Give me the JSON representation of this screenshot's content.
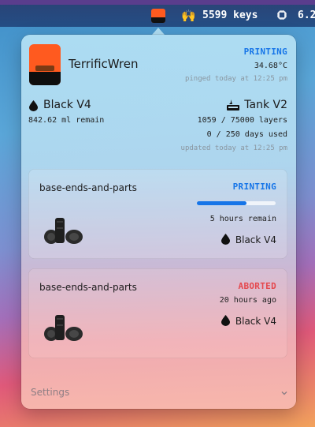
{
  "menubar": {
    "app_icon": "printer-app-icon",
    "raise_emoji": "🙌",
    "keys_text": "5599 keys",
    "chip_icon": "chip-icon",
    "right_text": "6.2"
  },
  "printer": {
    "name": "TerrificWren",
    "status": "PRINTING",
    "temperature": "34.68°C",
    "pinged": "pinged today at 12:25 pm"
  },
  "resin": {
    "name": "Black V4",
    "remain": "842.62 ml remain"
  },
  "tank": {
    "name": "Tank V2",
    "layers": "1059 / 75000 layers",
    "days": "0 / 250 days used",
    "updated": "updated today at 12:25 pm"
  },
  "jobs": [
    {
      "name": "base-ends-and-parts",
      "status": "PRINTING",
      "progress": 0.63,
      "time": "5 hours remain",
      "resin": "Black V4"
    },
    {
      "name": "base-ends-and-parts",
      "status": "ABORTED",
      "time": "20 hours ago",
      "resin": "Black V4"
    }
  ],
  "footer": {
    "settings": "Settings"
  },
  "colors": {
    "printing": "#1675e8",
    "aborted": "#e5484d",
    "brand": "#ff5a1f"
  }
}
